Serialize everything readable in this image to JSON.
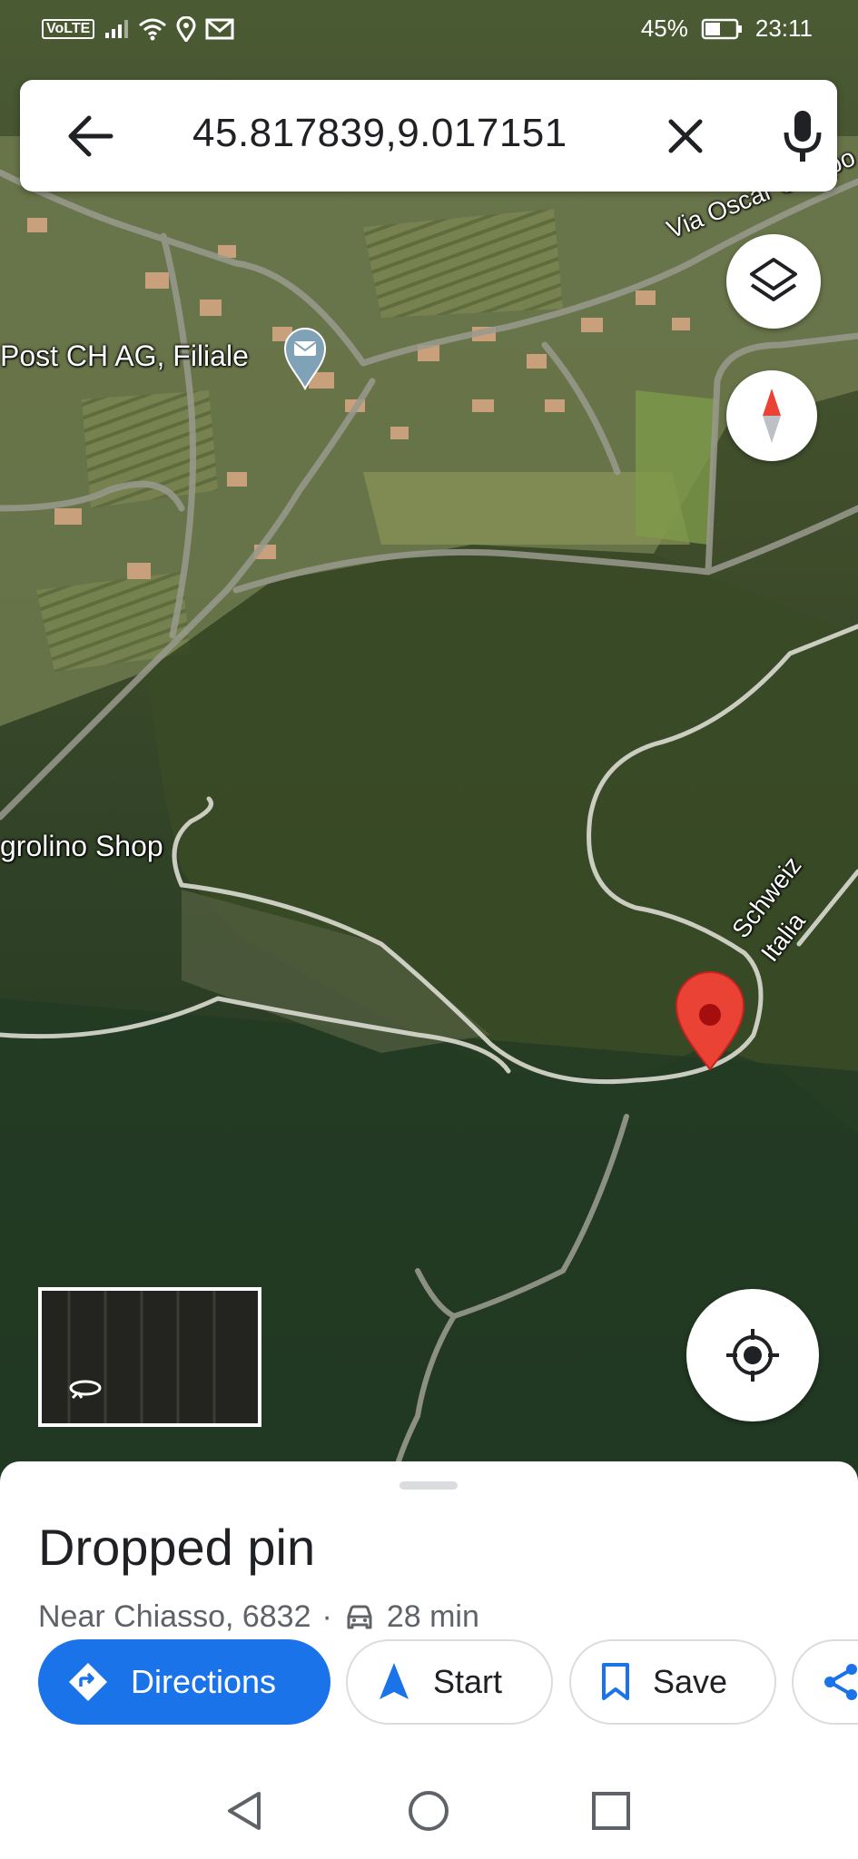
{
  "status_bar": {
    "volte": "VoLTE",
    "battery": "45%",
    "time": "23:11"
  },
  "search": {
    "query": "45.817839,9.017151",
    "back_icon": "arrow-left-icon",
    "clear_icon": "close-icon",
    "mic_icon": "microphone-icon"
  },
  "map": {
    "labels": {
      "road": "Via Oscar Campo",
      "poi": "Post CH AG, Filiale",
      "shop": "grolino Shop",
      "border_ch": "Schweiz",
      "border_it": "Italia"
    },
    "pin_color": "#ea4335"
  },
  "sheet": {
    "title": "Dropped pin",
    "subtitle_place": "Near Chiasso, 6832",
    "separator": "·",
    "drive_time": "28 min",
    "buttons": {
      "directions": "Directions",
      "start": "Start",
      "save": "Save"
    }
  },
  "colors": {
    "accent": "#1a73e8",
    "pin": "#ea4335",
    "text_primary": "#202124",
    "text_secondary": "#5f6368"
  }
}
